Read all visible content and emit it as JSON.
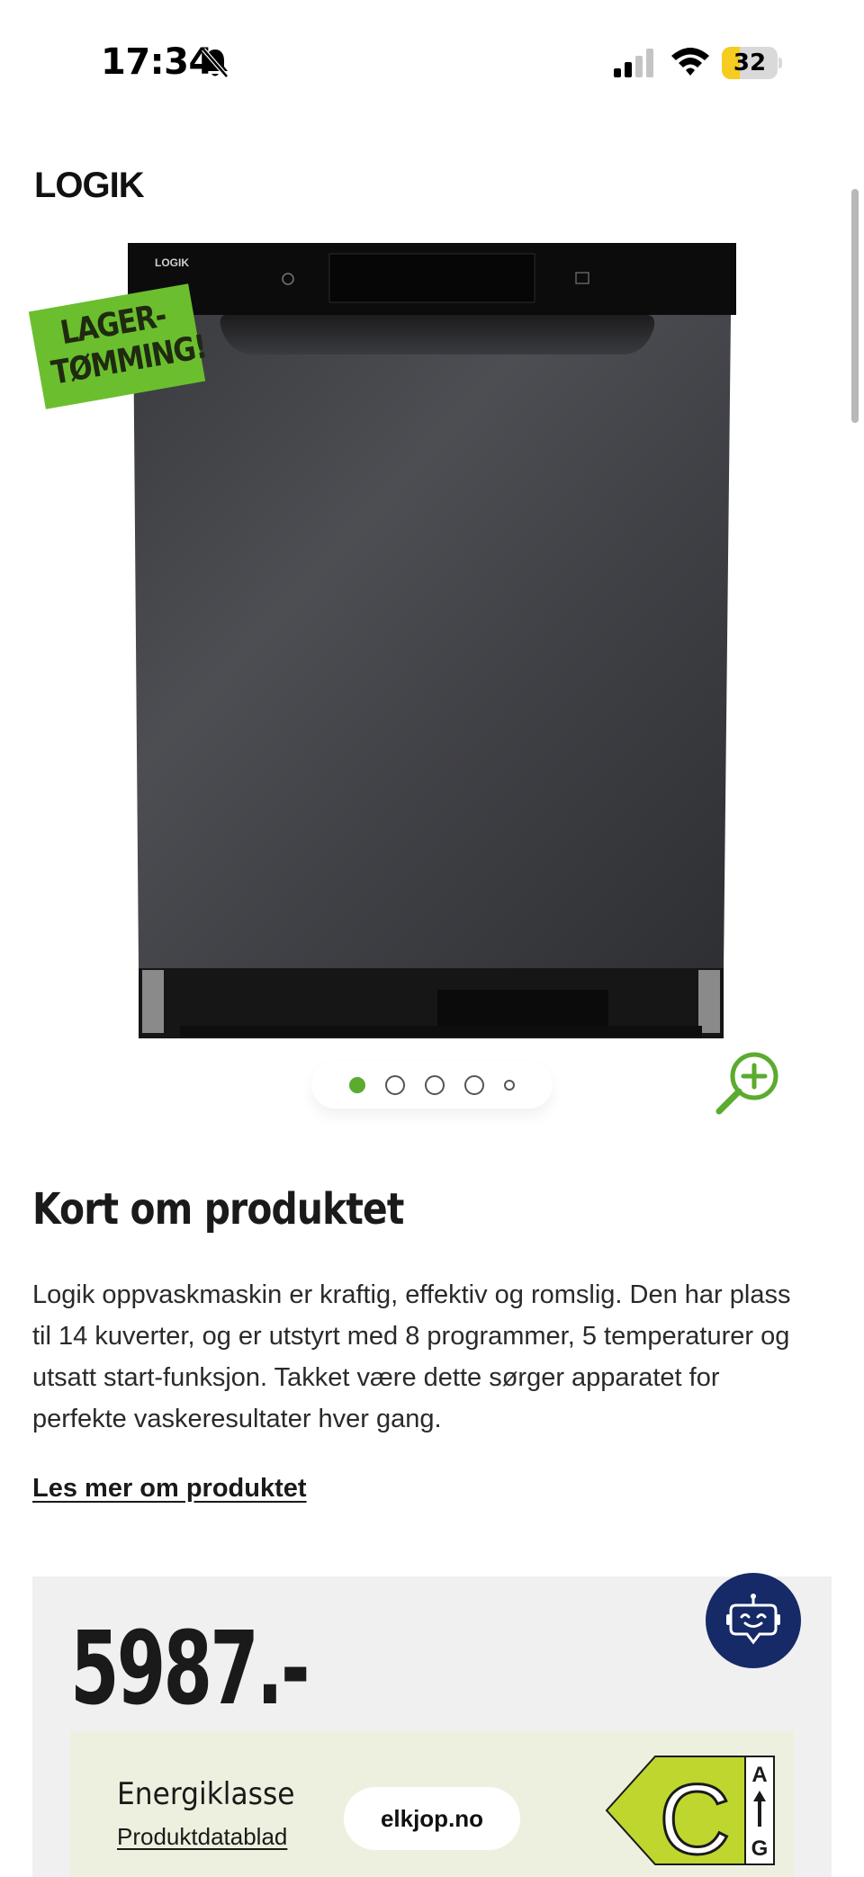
{
  "status_bar": {
    "time": "17:34",
    "battery_level": "32",
    "battery_fraction": 0.32,
    "icons": [
      "bell-off-icon",
      "signal-icon",
      "wifi-icon",
      "battery-icon"
    ]
  },
  "brand": {
    "logo_text": "LOGIK"
  },
  "product": {
    "image_icon": "dishwasher-image",
    "panel_logo": "LOGIK",
    "badge_text": "LAGER-\nTØMMING!",
    "badge_color": "#6bbf2e"
  },
  "carousel": {
    "slides": 5,
    "active_index": 0,
    "accent": "#5bab2f"
  },
  "about": {
    "title": "Kort om produktet",
    "text": "Logik oppvaskmaskin er kraftig, effektiv og romslig. Den har plass til 14 kuverter, og er utstyrt med 8 programmer, 5 temperaturer og utsatt start-funksjon. Takket være dette sørger apparatet for perfekte vaskeresultater hver gang.",
    "read_more": "Les mer om produktet"
  },
  "price": {
    "value": "5987.-"
  },
  "chat": {
    "icon": "chat-bot-icon",
    "color": "#152a66"
  },
  "energy": {
    "label": "Energiklasse",
    "datasheet_link": "Produktdatablad",
    "site_chip": "elkjop.no",
    "class": "C",
    "scale_top": "A",
    "scale_bottom": "G",
    "class_color": "#bfd62f"
  }
}
